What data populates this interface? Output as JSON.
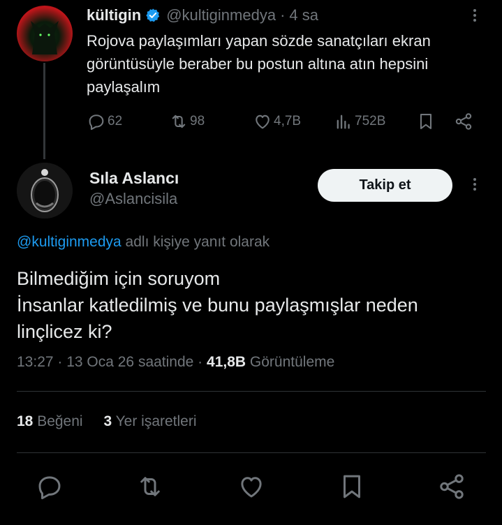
{
  "top_tweet": {
    "name": "kültigin",
    "handle": "@kultiginmedya",
    "separator": "·",
    "time": "4 sa",
    "text": "Rojova paylaşımları yapan sözde sanatçıları ekran görüntüsüyle beraber bu postun altına atın hepsini paylaşalım",
    "actions": {
      "replies": "62",
      "reposts": "98",
      "likes": "4,7B",
      "views": "752B"
    }
  },
  "main_tweet": {
    "name": "Sıla Aslancı",
    "handle": "@Aslancisila",
    "follow_label": "Takip et",
    "reply_to_mention": "@kultiginmedya",
    "reply_to_suffix": " adlı kişiye yanıt olarak",
    "text_line1": "Bilmediğim için soruyom",
    "text_line2": "İnsanlar katledilmiş ve bunu paylaşmışlar neden linçlicez ki?",
    "timestamp": "13:27 · 13 Oca 26 saatinde · ",
    "views_count": "41,8B",
    "views_label": " Görüntüleme",
    "likes_count": "18",
    "likes_label": " Beğeni",
    "bookmarks_count": "3",
    "bookmarks_label": " Yer işaretleri"
  },
  "colors": {
    "background": "#000000",
    "text": "#e7e9ea",
    "secondary": "#71767b",
    "link": "#1d9bf0",
    "verified": "#1d9bf0"
  }
}
